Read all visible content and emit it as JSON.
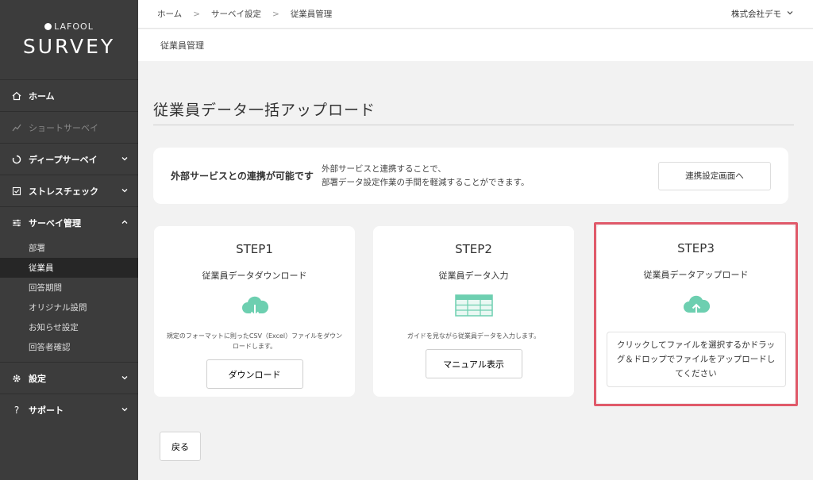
{
  "logo": {
    "brand": "LAFOOL",
    "product": "SURVEY"
  },
  "sidebar": {
    "items": [
      {
        "label": "ホーム",
        "icon": "home-icon"
      },
      {
        "label": "ショートサーベイ",
        "icon": "trend-icon"
      },
      {
        "label": "ディープサーベイ",
        "icon": "circle-icon"
      },
      {
        "label": "ストレスチェック",
        "icon": "checkbox-icon"
      },
      {
        "label": "サーベイ管理",
        "icon": "sliders-icon"
      },
      {
        "label": "設定",
        "icon": "gear-icon"
      },
      {
        "label": "サポート",
        "icon": "help-icon"
      }
    ],
    "survey_admin_sub": [
      "部署",
      "従業員",
      "回答期間",
      "オリジナル設問",
      "お知らせ設定",
      "回答者確認"
    ]
  },
  "topbar": {
    "breadcrumbs": [
      "ホーム",
      "サーベイ設定",
      "従業員管理"
    ],
    "company": "株式会社デモ"
  },
  "subheader": {
    "title": "従業員管理"
  },
  "page": {
    "title": "従業員データ一括アップロード"
  },
  "integration": {
    "title": "外部サービスとの連携が可能です",
    "desc_line1": "外部サービスと連携することで、",
    "desc_line2": "部署データ設定作業の手間を軽減することができます。",
    "button": "連携設定画面へ"
  },
  "steps": [
    {
      "step": "STEP1",
      "title": "従業員データダウンロード",
      "desc": "規定のフォーマットに則ったCSV（Excel）ファイルをダウンロードします。",
      "button": "ダウンロード"
    },
    {
      "step": "STEP2",
      "title": "従業員データ入力",
      "desc": "ガイドを見ながら従業員データを入力します。",
      "button": "マニュアル表示"
    },
    {
      "step": "STEP3",
      "title": "従業員データアップロード",
      "dropzone": "クリックしてファイルを選択するかドラッグ＆ドロップでファイルをアップロードしてください"
    }
  ],
  "back": "戻る",
  "colors": {
    "sidebar": "#3c3c3c",
    "accent": "#6dcfb0",
    "highlight": "#e05a6a"
  }
}
